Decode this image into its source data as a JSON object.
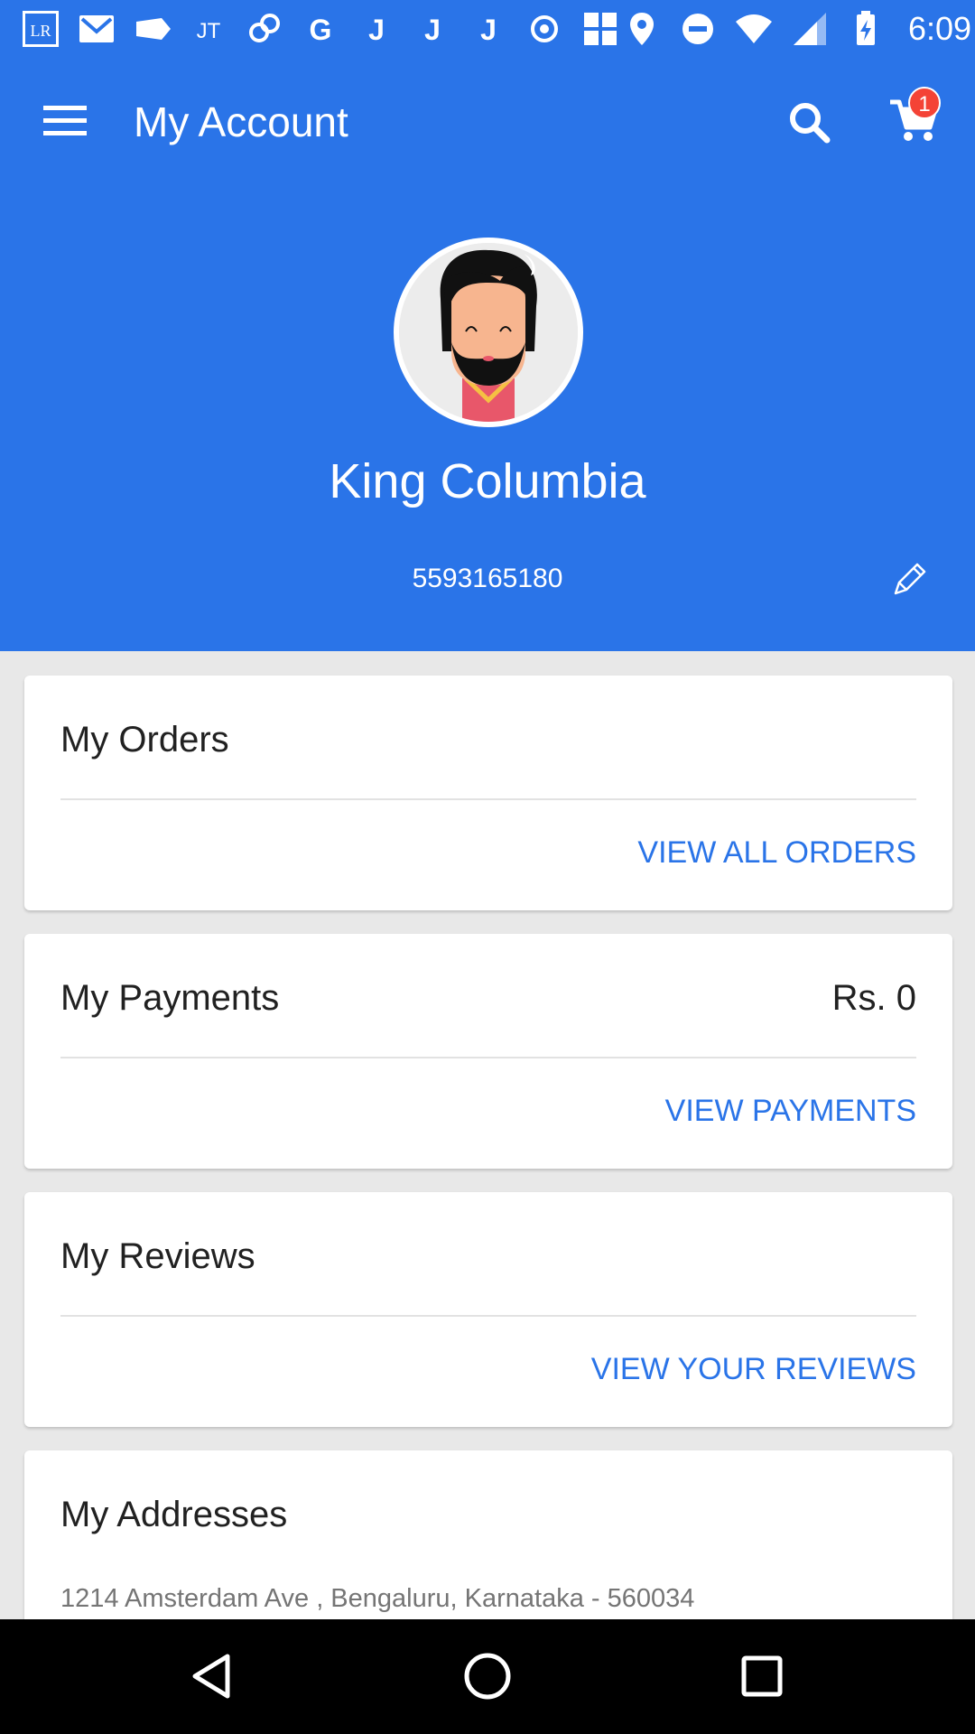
{
  "status_bar": {
    "time": "6:09",
    "notification_icons": [
      "lr-app-icon",
      "gmail-icon",
      "tag-icon",
      "jt-app-icon",
      "link-app-icon",
      "google-icon",
      "j-app-icon",
      "j-app-icon",
      "j-app-icon",
      "record-icon",
      "grid-app-icon"
    ],
    "lr_label": "LR",
    "jt_label": "JT",
    "g_label": "G",
    "j_label": "J"
  },
  "app_bar": {
    "title": "My Account",
    "cart_count": "1"
  },
  "profile": {
    "name": "King Columbia",
    "phone": "5593165180"
  },
  "cards": {
    "orders": {
      "title": "My Orders",
      "action": "VIEW ALL ORDERS"
    },
    "payments": {
      "title": "My Payments",
      "value": "Rs. 0",
      "action": "VIEW PAYMENTS"
    },
    "reviews": {
      "title": "My Reviews",
      "action": "VIEW YOUR REVIEWS"
    },
    "addresses": {
      "title": "My Addresses",
      "address": "1214 Amsterdam Ave , Bengaluru, Karnataka - 560034"
    }
  },
  "colors": {
    "primary": "#2a74e8",
    "badge": "#f44336",
    "background": "#e8e8e8"
  }
}
